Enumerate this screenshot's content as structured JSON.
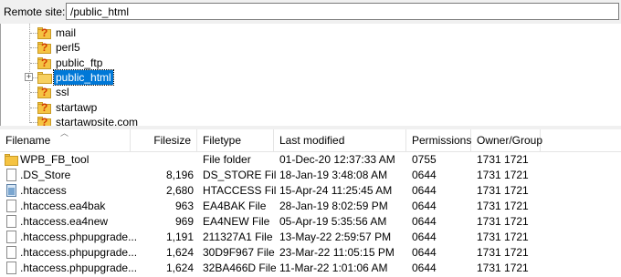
{
  "remote_site": {
    "label": "Remote site:",
    "path": "/public_html"
  },
  "tree": {
    "items": [
      {
        "label": "mail",
        "icon": "question-folder-icon",
        "selected": false
      },
      {
        "label": "perl5",
        "icon": "question-folder-icon",
        "selected": false
      },
      {
        "label": "public_ftp",
        "icon": "question-folder-icon",
        "selected": false
      },
      {
        "label": "public_html",
        "icon": "open-folder-icon",
        "selected": true,
        "expander": "+"
      },
      {
        "label": "ssl",
        "icon": "question-folder-icon",
        "selected": false
      },
      {
        "label": "startawp",
        "icon": "question-folder-icon",
        "selected": false
      },
      {
        "label": "startawpsite.com",
        "icon": "question-folder-icon",
        "selected": false
      }
    ]
  },
  "file_list": {
    "columns": {
      "filename": "Filename",
      "filesize": "Filesize",
      "filetype": "Filetype",
      "last_modified": "Last modified",
      "permissions": "Permissions",
      "owner_group": "Owner/Group"
    },
    "rows": [
      {
        "name": "WPB_FB_tool",
        "size": "",
        "type": "File folder",
        "modified": "01-Dec-20 12:37:33 AM",
        "perm": "0755",
        "owner": "1731 1721",
        "icon": "folder-icon"
      },
      {
        "name": ".DS_Store",
        "size": "8,196",
        "type": "DS_STORE File",
        "modified": "18-Jan-19 3:48:08 AM",
        "perm": "0644",
        "owner": "1731 1721",
        "icon": "file-icon"
      },
      {
        "name": ".htaccess",
        "size": "2,680",
        "type": "HTACCESS File",
        "modified": "15-Apr-24 11:25:45 AM",
        "perm": "0644",
        "owner": "1731 1721",
        "icon": "htaccess-file-icon"
      },
      {
        "name": ".htaccess.ea4bak",
        "size": "963",
        "type": "EA4BAK File",
        "modified": "28-Jan-19 8:02:59 PM",
        "perm": "0644",
        "owner": "1731 1721",
        "icon": "file-icon"
      },
      {
        "name": ".htaccess.ea4new",
        "size": "969",
        "type": "EA4NEW File",
        "modified": "05-Apr-19 5:35:56 AM",
        "perm": "0644",
        "owner": "1731 1721",
        "icon": "file-icon"
      },
      {
        "name": ".htaccess.phpupgrade...",
        "size": "1,191",
        "type": "211327A1 File",
        "modified": "13-May-22 2:59:57 PM",
        "perm": "0644",
        "owner": "1731 1721",
        "icon": "file-icon"
      },
      {
        "name": ".htaccess.phpupgrade...",
        "size": "1,624",
        "type": "30D9F967 File",
        "modified": "23-Mar-22 11:05:15 PM",
        "perm": "0644",
        "owner": "1731 1721",
        "icon": "file-icon"
      },
      {
        "name": ".htaccess.phpupgrade...",
        "size": "1,624",
        "type": "32BA466D File",
        "modified": "11-Mar-22 1:01:06 AM",
        "perm": "0644",
        "owner": "1731 1721",
        "icon": "file-icon"
      }
    ]
  },
  "colors": {
    "selection": "#0078d7",
    "folder": "#f5c342",
    "question_mark": "#d23c00"
  }
}
